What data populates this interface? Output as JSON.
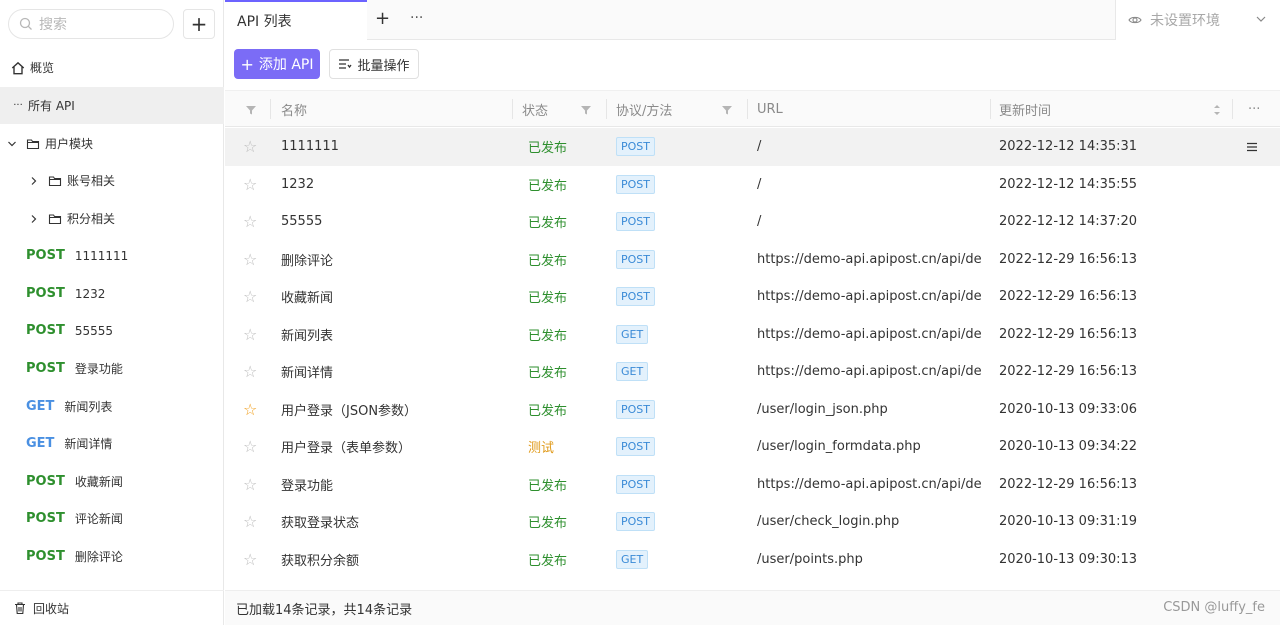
{
  "sidebar": {
    "search_placeholder": "搜索",
    "add_label": "+",
    "overview": "概览",
    "all_api": "所有 API",
    "folder_user": "用户模块",
    "sub_folders": [
      "账号相关",
      "积分相关"
    ],
    "apis": [
      {
        "method": "POST",
        "name": "1111111"
      },
      {
        "method": "POST",
        "name": "1232"
      },
      {
        "method": "POST",
        "name": "55555"
      },
      {
        "method": "POST",
        "name": "登录功能"
      },
      {
        "method": "GET",
        "name": "新闻列表"
      },
      {
        "method": "GET",
        "name": "新闻详情"
      },
      {
        "method": "POST",
        "name": "收藏新闻"
      },
      {
        "method": "POST",
        "name": "评论新闻"
      },
      {
        "method": "POST",
        "name": "删除评论"
      }
    ],
    "trash": "回收站"
  },
  "tabs": {
    "active": "API 列表",
    "plus": "+",
    "more": "···"
  },
  "env": {
    "label": "未设置环境"
  },
  "toolbar": {
    "add_api": "添加 API",
    "bulk": "批量操作"
  },
  "table": {
    "headers": {
      "name": "名称",
      "status": "状态",
      "protocol": "协议/方法",
      "url": "URL",
      "updated": "更新时间",
      "more": "···"
    },
    "rows": [
      {
        "starred": false,
        "name": "1111111",
        "status": "已发布",
        "method": "POST",
        "url": "/",
        "updated": "2022-12-12 14:35:31"
      },
      {
        "starred": false,
        "name": "1232",
        "status": "已发布",
        "method": "POST",
        "url": "/",
        "updated": "2022-12-12 14:35:55"
      },
      {
        "starred": false,
        "name": "55555",
        "status": "已发布",
        "method": "POST",
        "url": "/",
        "updated": "2022-12-12 14:37:20"
      },
      {
        "starred": false,
        "name": "删除评论",
        "status": "已发布",
        "method": "POST",
        "url": "https://demo-api.apipost.cn/api/de...",
        "updated": "2022-12-29 16:56:13"
      },
      {
        "starred": false,
        "name": "收藏新闻",
        "status": "已发布",
        "method": "POST",
        "url": "https://demo-api.apipost.cn/api/de...",
        "updated": "2022-12-29 16:56:13"
      },
      {
        "starred": false,
        "name": "新闻列表",
        "status": "已发布",
        "method": "GET",
        "url": "https://demo-api.apipost.cn/api/de...",
        "updated": "2022-12-29 16:56:13"
      },
      {
        "starred": false,
        "name": "新闻详情",
        "status": "已发布",
        "method": "GET",
        "url": "https://demo-api.apipost.cn/api/de...",
        "updated": "2022-12-29 16:56:13"
      },
      {
        "starred": true,
        "name": "用户登录（JSON参数）",
        "status": "已发布",
        "method": "POST",
        "url": "/user/login_json.php",
        "updated": "2020-10-13 09:33:06"
      },
      {
        "starred": false,
        "name": "用户登录（表单参数）",
        "status": "测试",
        "method": "POST",
        "url": "/user/login_formdata.php",
        "updated": "2020-10-13 09:34:22"
      },
      {
        "starred": false,
        "name": "登录功能",
        "status": "已发布",
        "method": "POST",
        "url": "https://demo-api.apipost.cn/api/de...",
        "updated": "2022-12-29 16:56:13"
      },
      {
        "starred": false,
        "name": "获取登录状态",
        "status": "已发布",
        "method": "POST",
        "url": "/user/check_login.php",
        "updated": "2020-10-13 09:31:19"
      },
      {
        "starred": false,
        "name": "获取积分余额",
        "status": "已发布",
        "method": "GET",
        "url": "/user/points.php",
        "updated": "2020-10-13 09:30:13"
      }
    ]
  },
  "footer": {
    "summary": "已加载14条记录，共14条记录"
  },
  "watermark": "CSDN @luffy_fe",
  "colors": {
    "accent": "#7b6cf6",
    "post": "#2e8f2e",
    "get": "#4a90e2",
    "published": "#2e8f2e",
    "testing": "#e09a1a",
    "star_on": "#f0a020"
  }
}
